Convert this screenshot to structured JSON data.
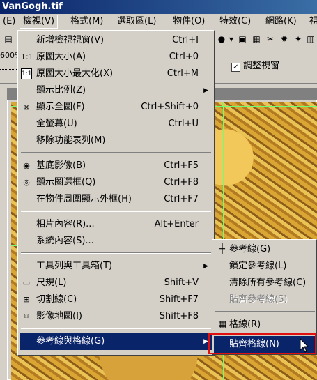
{
  "window": {
    "title": "VanGogh.tif"
  },
  "menubar": {
    "items": [
      {
        "label": "(E)"
      },
      {
        "label": "檢視(V)"
      },
      {
        "label": "格式(M)"
      },
      {
        "label": "選取區(L)"
      },
      {
        "label": "物件(O)"
      },
      {
        "label": "特效(C)"
      },
      {
        "label": "網路(K)"
      },
      {
        "label": "視"
      }
    ]
  },
  "toolbar": {
    "zoom_fragment": "600%",
    "adjust_view_label": "調整視窗",
    "adjust_view_checked": true
  },
  "view_menu": {
    "items": [
      {
        "label": "新增檢視視窗(V)",
        "shortcut": "Ctrl+I",
        "icon": ""
      },
      {
        "label": "原圖大小(A)",
        "shortcut": "Ctrl+0",
        "icon": "1:1"
      },
      {
        "label": "原圖大小最大化(X)",
        "shortcut": "Ctrl+M",
        "icon": "1:1"
      },
      {
        "label": "顯示比例(Z)",
        "shortcut": "",
        "icon": "",
        "submenu": true
      },
      {
        "label": "顯示全圖(F)",
        "shortcut": "Ctrl+Shift+0",
        "icon": "fit-icon"
      },
      {
        "label": "全螢幕(U)",
        "shortcut": "Ctrl+U",
        "icon": ""
      },
      {
        "label": "移除功能表列(M)",
        "shortcut": "",
        "icon": ""
      },
      {
        "label": "基底影像(B)",
        "shortcut": "Ctrl+F5",
        "icon": "eye-icon"
      },
      {
        "label": "顯示圈選框(Q)",
        "shortcut": "Ctrl+F8",
        "icon": "marquee-eye-icon"
      },
      {
        "label": "在物件周圍顯示外框(H)",
        "shortcut": "Ctrl+F7",
        "icon": ""
      },
      {
        "label": "相片內容(R)...",
        "shortcut": "Alt+Enter",
        "icon": ""
      },
      {
        "label": "系統內容(S)...",
        "shortcut": "",
        "icon": ""
      },
      {
        "label": "工具列與工具箱(T)",
        "shortcut": "",
        "icon": "",
        "submenu": true
      },
      {
        "label": "尺規(L)",
        "shortcut": "Shift+V",
        "icon": "ruler-icon"
      },
      {
        "label": "切割線(C)",
        "shortcut": "Shift+F7",
        "icon": "grid-icon"
      },
      {
        "label": "影像地圖(I)",
        "shortcut": "Shift+F8",
        "icon": "imagemap-icon"
      },
      {
        "label": "參考線與格線(G)",
        "shortcut": "",
        "icon": "",
        "submenu": true,
        "highlighted": true
      }
    ]
  },
  "guides_submenu": {
    "items": [
      {
        "label": "參考線(G)",
        "icon": "crosshair-icon"
      },
      {
        "label": "鎖定參考線(L)",
        "icon": ""
      },
      {
        "label": "清除所有參考線(C)",
        "icon": ""
      },
      {
        "label": "貼齊參考線(S)",
        "icon": "",
        "disabled": true
      },
      {
        "label": "格線(R)",
        "icon": "grid-dots-icon"
      },
      {
        "label": "貼齊格線(N)",
        "icon": "",
        "highlighted": true
      }
    ]
  },
  "colors": {
    "menu_bg": "#d4d0c8",
    "highlight": "#0a246a",
    "annotation_box": "#e01010",
    "grid_lines": "#70ff70"
  }
}
